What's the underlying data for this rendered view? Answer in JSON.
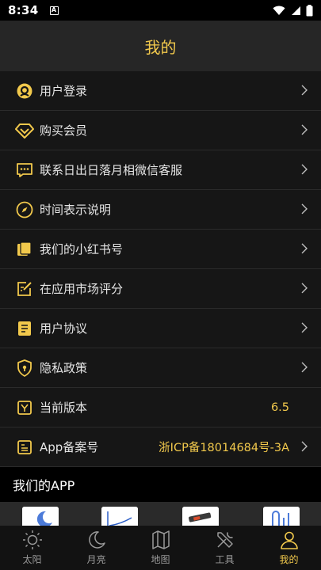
{
  "status": {
    "time": "8:34",
    "notif": "A"
  },
  "header": {
    "title": "我的"
  },
  "menu": [
    {
      "label": "用户登录",
      "icon": "user-circle-icon"
    },
    {
      "label": "购买会员",
      "icon": "diamond-icon"
    },
    {
      "label": "联系日出日落月相微信客服",
      "icon": "chat-bubble-icon"
    },
    {
      "label": "时间表示说明",
      "icon": "compass-icon"
    },
    {
      "label": "我们的小红书号",
      "icon": "notebook-icon"
    },
    {
      "label": "在应用市场评分",
      "icon": "edit-square-icon"
    },
    {
      "label": "用户协议",
      "icon": "document-icon"
    },
    {
      "label": "隐私政策",
      "icon": "shield-icon"
    },
    {
      "label": "当前版本",
      "icon": "version-icon",
      "value": "6.5"
    },
    {
      "label": "App备案号",
      "icon": "record-icon",
      "value": "浙ICP备18014684号-3A"
    }
  ],
  "apps": {
    "title": "我们的APP"
  },
  "tabs": [
    {
      "label": "太阳",
      "icon": "sun-icon"
    },
    {
      "label": "月亮",
      "icon": "moon-icon"
    },
    {
      "label": "地图",
      "icon": "map-icon"
    },
    {
      "label": "工具",
      "icon": "tools-icon"
    },
    {
      "label": "我的",
      "icon": "person-icon",
      "active": true
    }
  ],
  "colors": {
    "accent": "#f2c94c",
    "background": "#161616",
    "header": "#262626"
  }
}
